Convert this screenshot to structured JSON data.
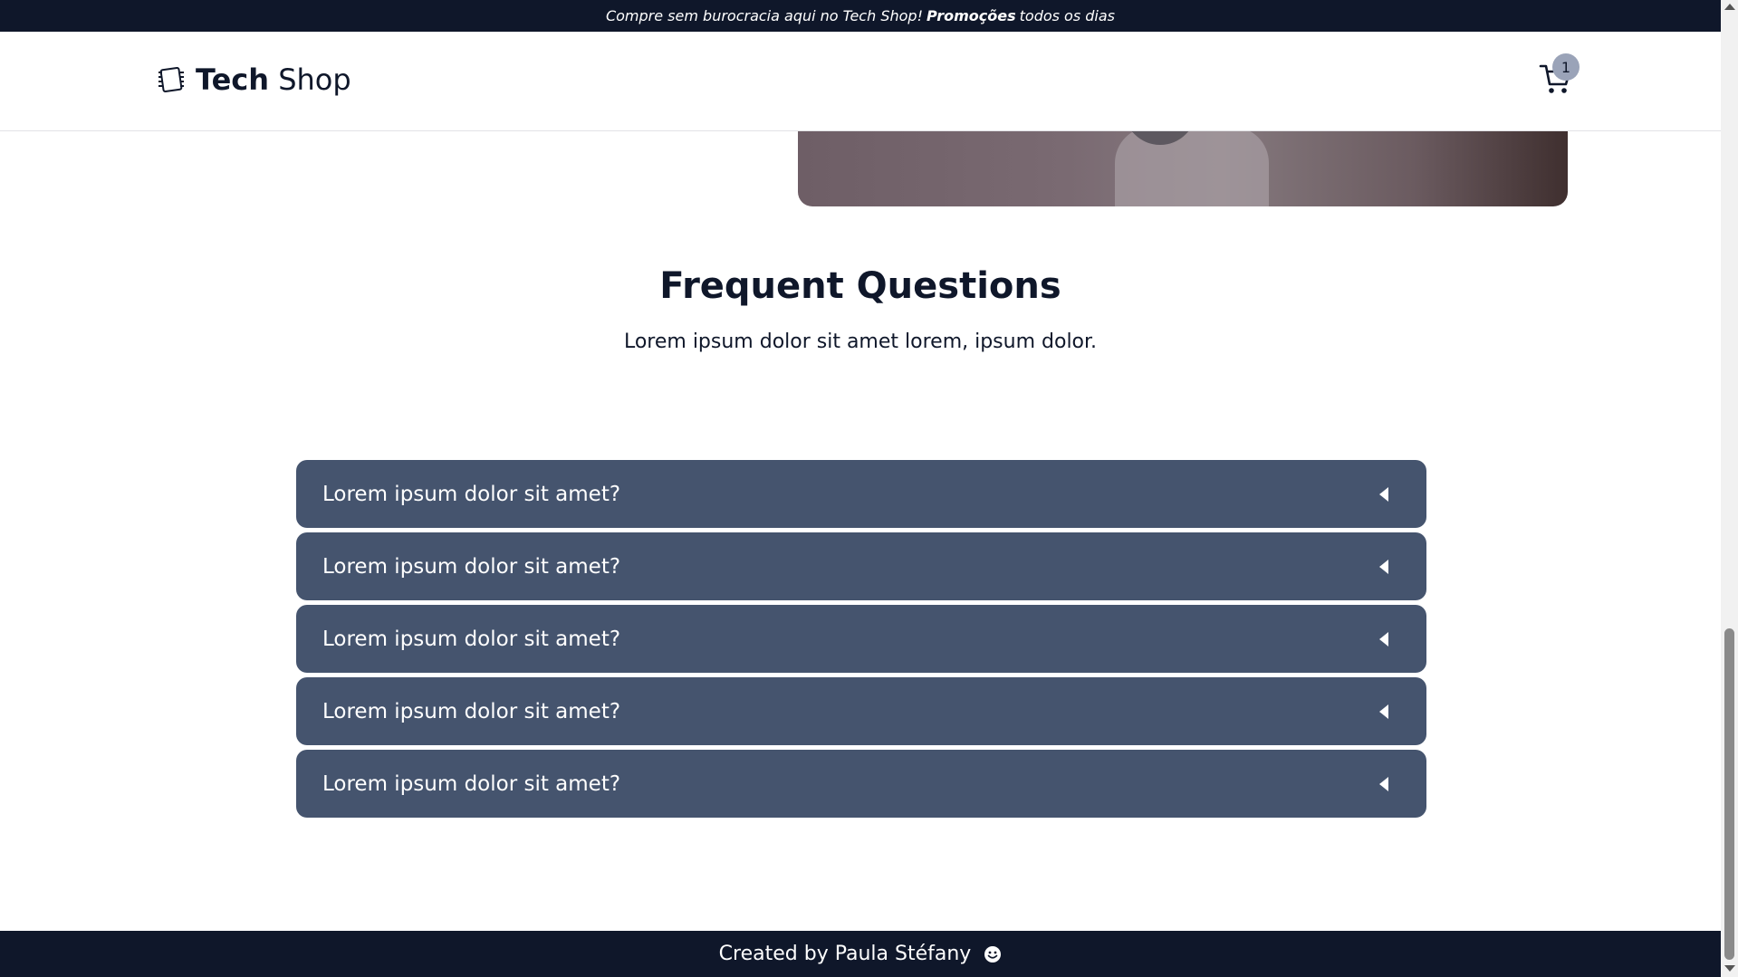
{
  "announcement": {
    "prefix": "Compre sem burocracia aqui no Tech Shop!",
    "highlight": "Promoções",
    "suffix": "todos os dias"
  },
  "header": {
    "brand_bold": "Tech",
    "brand_regular": "Shop",
    "logo_icon": "chip-icon",
    "cart_icon": "cart-icon",
    "cart_count": "1"
  },
  "faq": {
    "title": "Frequent Questions",
    "subtitle": "Lorem ipsum dolor sit amet lorem, ipsum dolor.",
    "items": [
      {
        "question": "Lorem ipsum dolor sit amet?"
      },
      {
        "question": "Lorem ipsum dolor sit amet?"
      },
      {
        "question": "Lorem ipsum dolor sit amet?"
      },
      {
        "question": "Lorem ipsum dolor sit amet?"
      },
      {
        "question": "Lorem ipsum dolor sit amet?"
      }
    ]
  },
  "footer": {
    "credit": "Created by Paula Stéfany",
    "icon": "smile-icon"
  },
  "colors": {
    "navy": "#0f172a",
    "accordion": "#45546e",
    "badge": "#9aa3b8"
  }
}
